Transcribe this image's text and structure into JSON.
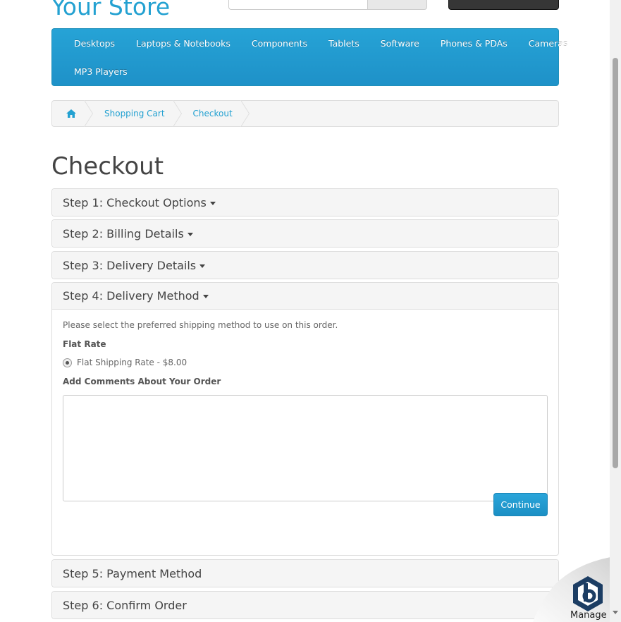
{
  "header": {
    "store_title": "Your Store"
  },
  "menu": {
    "row1": [
      "Desktops",
      "Laptops & Notebooks",
      "Components",
      "Tablets",
      "Software",
      "Phones & PDAs",
      "Cameras"
    ],
    "row2": [
      "MP3 Players"
    ]
  },
  "breadcrumb": {
    "home_icon": "home-icon",
    "items": [
      "Shopping Cart",
      "Checkout"
    ]
  },
  "page": {
    "title": "Checkout"
  },
  "steps": [
    {
      "label": "Step 1: Checkout Options",
      "caret": true
    },
    {
      "label": "Step 2: Billing Details",
      "caret": true
    },
    {
      "label": "Step 3: Delivery Details",
      "caret": true
    },
    {
      "label": "Step 4: Delivery Method",
      "caret": true
    },
    {
      "label": "Step 5: Payment Method",
      "caret": false
    },
    {
      "label": "Step 6: Confirm Order",
      "caret": false
    }
  ],
  "delivery": {
    "instruction": "Please select the preferred shipping method to use on this order.",
    "method_title": "Flat Rate",
    "option_label": "Flat Shipping Rate - $8.00",
    "comments_label": "Add Comments About Your Order",
    "comments_value": "",
    "continue_label": "Continue"
  },
  "widget": {
    "manage_label": "Manage"
  },
  "colors": {
    "accent": "#23a1d1",
    "menu_bg": "#229ac8"
  }
}
